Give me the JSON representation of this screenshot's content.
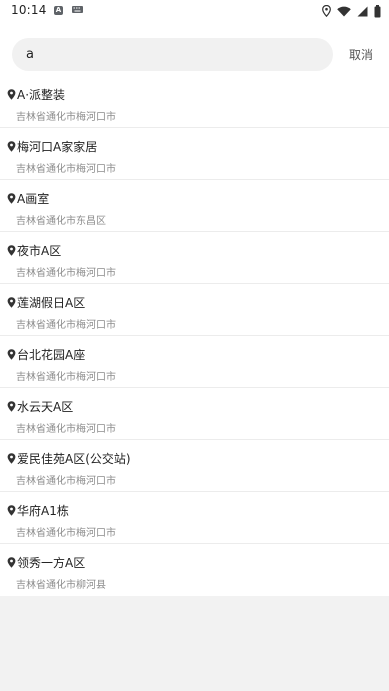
{
  "status_bar": {
    "time": "10:14",
    "notification_letter": "A",
    "icons": [
      "location-icon",
      "wifi-icon",
      "cellular-icon",
      "battery-icon"
    ]
  },
  "search": {
    "value": "a",
    "cancel_label": "取消"
  },
  "results": [
    {
      "name": "A·派整装",
      "address": "吉林省通化市梅河口市"
    },
    {
      "name": "梅河口A家家居",
      "address": "吉林省通化市梅河口市"
    },
    {
      "name": "A画室",
      "address": "吉林省通化市东昌区"
    },
    {
      "name": "夜市A区",
      "address": "吉林省通化市梅河口市"
    },
    {
      "name": "莲湖假日A区",
      "address": "吉林省通化市梅河口市"
    },
    {
      "name": "台北花园A座",
      "address": "吉林省通化市梅河口市"
    },
    {
      "name": "水云天A区",
      "address": "吉林省通化市梅河口市"
    },
    {
      "name": "爱民佳苑A区(公交站)",
      "address": "吉林省通化市梅河口市"
    },
    {
      "name": "华府A1栋",
      "address": "吉林省通化市梅河口市"
    },
    {
      "name": "领秀一方A区",
      "address": "吉林省通化市柳河县"
    }
  ],
  "colors": {
    "background": "#f2f2f2",
    "list_background": "#ffffff",
    "search_field": "#f1f1f1",
    "secondary_text": "#8c8c8c"
  }
}
